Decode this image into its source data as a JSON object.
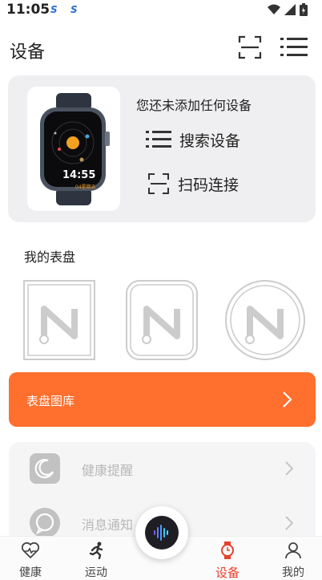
{
  "status": {
    "time": "11:05",
    "app1": "S",
    "app2": "S"
  },
  "header": {
    "title": "设备"
  },
  "device_card": {
    "message": "您还未添加任何设备",
    "watch_time": "14:55",
    "watch_sub": "04星期五",
    "search_label": "搜索设备",
    "scan_label": "扫码连接"
  },
  "dials": {
    "title": "我的表盘"
  },
  "gallery": {
    "label": "表盘图库"
  },
  "settings": [
    {
      "label": "健康提醒",
      "icon": "moon-icon"
    },
    {
      "label": "消息通知",
      "icon": "chat-icon"
    }
  ],
  "tabs": [
    {
      "label": "健康",
      "icon": "heart-icon"
    },
    {
      "label": "运动",
      "icon": "running-icon"
    },
    {
      "label": "设备",
      "icon": "watch-icon"
    },
    {
      "label": "我的",
      "icon": "person-icon"
    }
  ],
  "colors": {
    "accent": "#ff6f2e",
    "active_tab": "#e8402d",
    "card_bg": "#efeff1"
  }
}
